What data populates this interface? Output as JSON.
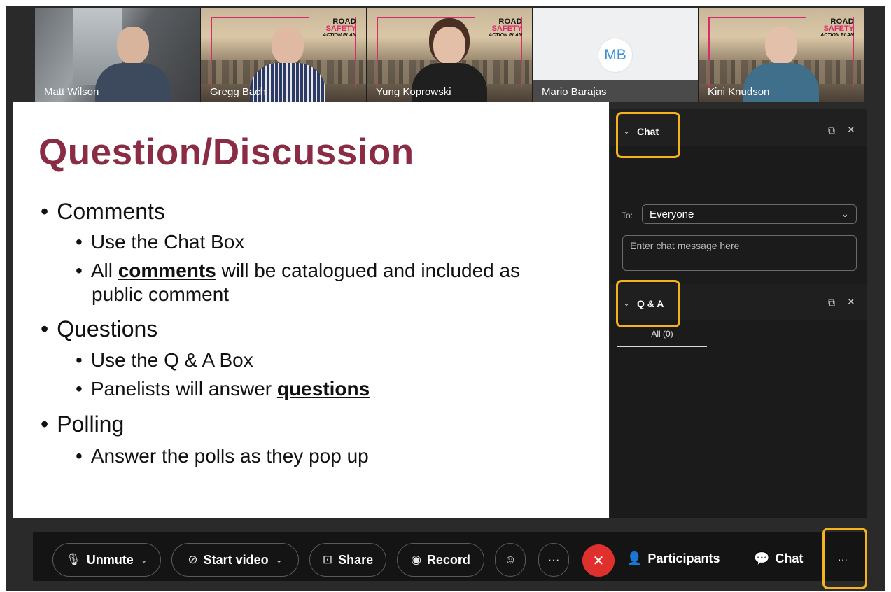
{
  "participants": [
    {
      "name": "Matt Wilson",
      "type": "video"
    },
    {
      "name": "Gregg Bach",
      "type": "video",
      "logo": [
        "ROAD",
        "SAFETY",
        "ACTION PLAN"
      ]
    },
    {
      "name": "Yung Koprowski",
      "type": "video",
      "logo": [
        "ROAD",
        "SAFETY",
        "ACTION PLAN"
      ]
    },
    {
      "name": "Mario Barajas",
      "type": "avatar",
      "initials": "MB"
    },
    {
      "name": "Kini Knudson",
      "type": "video",
      "logo": [
        "ROAD",
        "SAFETY",
        "ACTION PLAN"
      ]
    }
  ],
  "slide": {
    "title": "Question/Discussion",
    "sections": [
      {
        "heading": "Comments",
        "items": [
          "Use the Chat Box",
          {
            "pre": "All ",
            "emph": "comments",
            "post": " will be catalogued and included as",
            "cont": "public comment"
          }
        ]
      },
      {
        "heading": "Questions",
        "items": [
          "Use the Q & A Box",
          {
            "pre": "Panelists will answer ",
            "emph": "questions",
            "post": ""
          }
        ]
      },
      {
        "heading": "Polling",
        "items": [
          "Answer the polls as they pop up"
        ]
      }
    ],
    "title_color": "#8b2c45"
  },
  "chat_panel": {
    "title": "Chat",
    "to_label": "To:",
    "recipient": "Everyone",
    "input_placeholder": "Enter chat message here"
  },
  "qa_panel": {
    "title": "Q & A",
    "tab_label": "All (0)"
  },
  "toolbar": {
    "unmute": "Unmute",
    "start_video": "Start video",
    "share": "Share",
    "record": "Record",
    "more_dots": "···",
    "participants": "Participants",
    "chat": "Chat",
    "overflow": "···"
  },
  "colors": {
    "highlight": "#f5b21f",
    "leave": "#e0302e",
    "panel_bg": "#1b1b1b",
    "toolbar_bg": "#141414"
  }
}
